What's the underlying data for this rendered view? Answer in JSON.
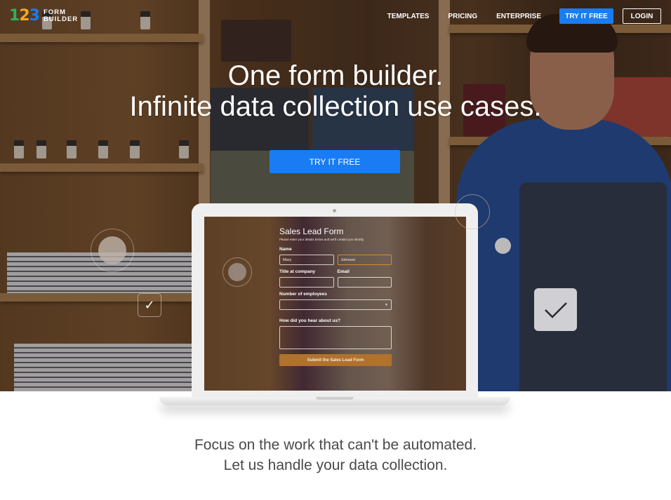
{
  "brand": {
    "logo_digits": [
      "1",
      "2",
      "3"
    ],
    "logo_line1": "FORM",
    "logo_line2": "BUILDER",
    "colors": {
      "green": "#2fb15a",
      "orange": "#f6a623",
      "blue": "#1a7cf2"
    }
  },
  "nav": {
    "links": [
      "TEMPLATES",
      "PRICING",
      "ENTERPRISE"
    ],
    "cta_label": "TRY IT FREE",
    "login_label": "LOGIN"
  },
  "hero": {
    "headline_line1": "One form builder.",
    "headline_line2": "Infinite data collection use cases.",
    "cta_label": "TRY IT FREE",
    "accent_color": "#1a7cf2"
  },
  "demo_form": {
    "title": "Sales Lead Form",
    "subtitle": "Please enter your details below and we'll contact you shortly.",
    "name_label": "Name",
    "first_name_value": "Mary",
    "last_name_value": "Johnson",
    "title_label": "Title at company",
    "email_label": "Email",
    "employees_label": "Number of employees",
    "hear_label": "How did you hear about us?",
    "submit_label": "Submit the Sales Lead Form",
    "submit_color": "#b0722d"
  },
  "decor": {
    "check_glyph": "✓"
  },
  "tagline": {
    "line1": "Focus on the work that can't be automated.",
    "line2": "Let us handle your data collection."
  }
}
